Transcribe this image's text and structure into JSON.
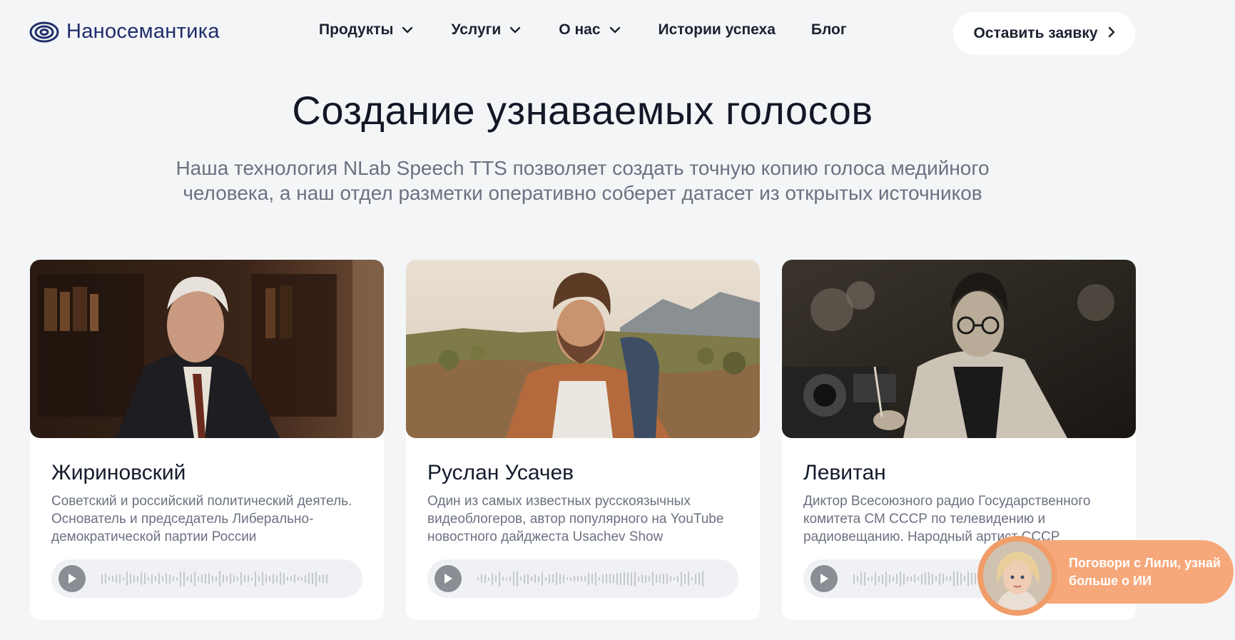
{
  "brand": {
    "name": "Наносемантика"
  },
  "nav": {
    "items": [
      {
        "label": "Продукты",
        "dropdown": true
      },
      {
        "label": "Услуги",
        "dropdown": true
      },
      {
        "label": "О нас",
        "dropdown": true
      },
      {
        "label": "Истории успеха",
        "dropdown": false
      },
      {
        "label": "Блог",
        "dropdown": false
      }
    ],
    "cta_label": "Оставить заявку",
    "cta_icon": "chevron-right-icon"
  },
  "hero": {
    "title": "Создание узнаваемых голосов",
    "subtitle_line1": "Наша технология NLab Speech TTS позволяет создать точную копию голоса медийного",
    "subtitle_line2": "человека, а наш отдел разметки оперативно соберет датасет из открытых источников"
  },
  "cards": [
    {
      "name": "Жириновский",
      "description": "Советский и российский политический деятель. Основатель и председатель Либерально-демократической партии России",
      "play_icon": "play-icon"
    },
    {
      "name": "Руслан Усачев",
      "description": "Один из самых известных русскоязычных видеоблогеров, автор популярного на YouTube новостного дайджеста Usachev Show",
      "play_icon": "play-icon"
    },
    {
      "name": "Левитан",
      "description": "Диктор Всесоюзного радио Государственного комитета СМ СССР по телевидению и радиовещанию. Народный артист СССР",
      "play_icon": "play-icon"
    }
  ],
  "chat_widget": {
    "line1": "Поговори с Лили, узнай",
    "line2": "больше о ИИ"
  },
  "colors": {
    "brand": "#1f2d6b",
    "accent": "#f7a87a",
    "background": "#f4f5f7",
    "text": "#141b2b",
    "muted": "#6b7180"
  }
}
